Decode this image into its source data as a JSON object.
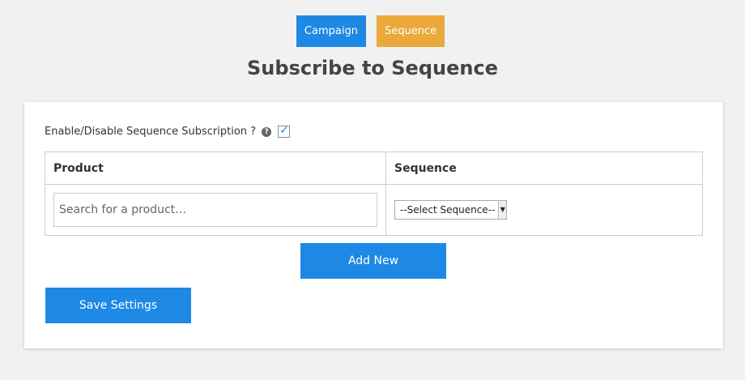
{
  "tabs": [
    {
      "label": "Campaign",
      "color": "#1e88e5"
    },
    {
      "label": "Sequence",
      "color": "#eaa93a"
    }
  ],
  "page_title": "Subscribe to Sequence",
  "subscription": {
    "label": "Enable/Disable Sequence Subscription ?",
    "help_icon": "?",
    "enabled": true
  },
  "table": {
    "headers": [
      "Product",
      "Sequence"
    ],
    "rows": [
      {
        "product_placeholder": "Search for a product…",
        "sequence_selected": "--Select Sequence--"
      }
    ]
  },
  "buttons": {
    "add_new": "Add New",
    "save_settings": "Save Settings"
  },
  "colors": {
    "primary": "#1e88e5",
    "accent": "#eaa93a"
  }
}
